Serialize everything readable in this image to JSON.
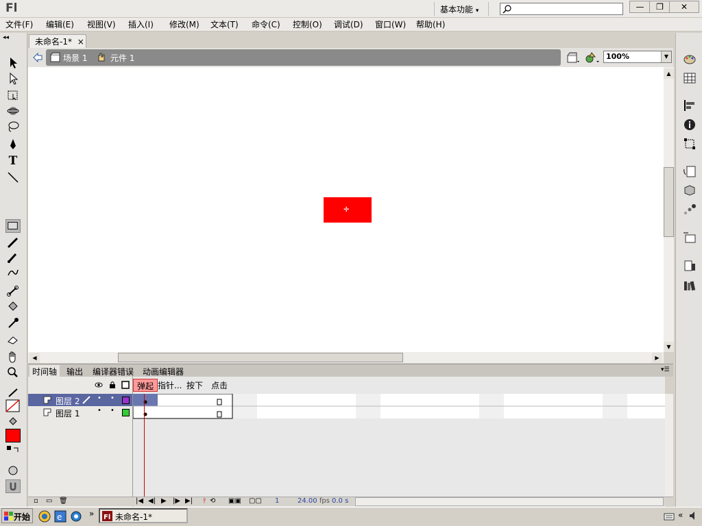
{
  "app": {
    "logo": "Fl",
    "workspace": "基本功能",
    "workspace_arrow": "▾"
  },
  "window_controls": {
    "minimize": "—",
    "restore": "❐",
    "close": "✕"
  },
  "menu": [
    "文件(F)",
    "编辑(E)",
    "视图(V)",
    "插入(I)",
    "修改(M)",
    "文本(T)",
    "命令(C)",
    "控制(O)",
    "调试(D)",
    "窗口(W)",
    "帮助(H)"
  ],
  "document": {
    "tab_title": "未命名-1*",
    "tab_close": "×"
  },
  "editbar": {
    "scene": "场景 1",
    "symbol": "元件 1",
    "zoom": "100%"
  },
  "panel_collapse": "◂◂",
  "timeline": {
    "tabs": [
      "时间轴",
      "输出",
      "编译器错误",
      "动画编辑器"
    ],
    "frame_labels": [
      "弹起",
      "指针...",
      "按下",
      "点击"
    ],
    "layers": [
      {
        "name": "图层 2",
        "color": "#9933cc",
        "selected": true
      },
      {
        "name": "图层 1",
        "color": "#33cc33",
        "selected": false
      }
    ],
    "footer": {
      "frame": "1",
      "fps": "24.00",
      "fps_unit": "fps",
      "time": "0.0 s"
    }
  },
  "colors": {
    "fill_swatch": "#ff0000",
    "stage_shape": "#ff0000"
  },
  "taskbar": {
    "start": "开始",
    "item": "未命名-1*",
    "more": "»"
  }
}
